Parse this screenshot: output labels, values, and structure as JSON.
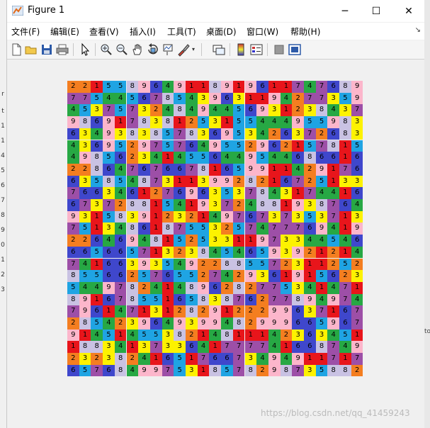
{
  "window": {
    "title": "Figure 1",
    "controls": {
      "minimize": "─",
      "maximize": "☐",
      "close": "✕"
    }
  },
  "menu": [
    "文件(F)",
    "编辑(E)",
    "查看(V)",
    "插入(I)",
    "工具(T)",
    "桌面(D)",
    "窗口(W)",
    "帮助(H)"
  ],
  "toolbar_icons": [
    "new-figure-icon",
    "open-icon",
    "save-icon",
    "print-icon",
    "pointer-icon",
    "zoom-in-icon",
    "zoom-out-icon",
    "pan-icon",
    "rotate-icon",
    "data-cursor-icon",
    "brush-icon",
    "link-icon",
    "colorbar-icon",
    "legend-icon",
    "hide-plot-tools-icon",
    "show-plot-tools-icon"
  ],
  "palette": {
    "1": "#e8151b",
    "2": "#f47e20",
    "3": "#fdf200",
    "4": "#27a844",
    "5": "#1fa4e3",
    "6": "#3f47cc",
    "7": "#9d4fa7",
    "8": "#c9c2e3",
    "9": "#fcb6cb"
  },
  "grid": [
    [
      2,
      2,
      1,
      5,
      5,
      8,
      9,
      6,
      4,
      9,
      1,
      1,
      8,
      9,
      1,
      9,
      6,
      1,
      1,
      7,
      4,
      7,
      6,
      8,
      9
    ],
    [
      7,
      7,
      5,
      4,
      4,
      5,
      6,
      7,
      8,
      5,
      4,
      3,
      9,
      6,
      3,
      1,
      1,
      9,
      4,
      2,
      7,
      7,
      3,
      5,
      9
    ],
    [
      4,
      5,
      3,
      7,
      5,
      7,
      3,
      2,
      4,
      8,
      4,
      9,
      4,
      4,
      5,
      6,
      9,
      3,
      1,
      2,
      3,
      8,
      4,
      3,
      7
    ],
    [
      9,
      8,
      6,
      9,
      1,
      7,
      8,
      3,
      8,
      1,
      2,
      5,
      3,
      1,
      5,
      5,
      4,
      4,
      4,
      9,
      5,
      5,
      9,
      8,
      3
    ],
    [
      6,
      3,
      4,
      9,
      3,
      8,
      3,
      8,
      5,
      7,
      8,
      3,
      6,
      9,
      5,
      3,
      4,
      2,
      6,
      3,
      7,
      2,
      6,
      8,
      3
    ],
    [
      4,
      3,
      6,
      9,
      5,
      2,
      9,
      7,
      5,
      7,
      6,
      4,
      9,
      5,
      5,
      2,
      9,
      6,
      2,
      1,
      5,
      7,
      8,
      1,
      5
    ],
    [
      4,
      9,
      8,
      5,
      6,
      2,
      3,
      4,
      1,
      4,
      5,
      5,
      6,
      4,
      4,
      9,
      5,
      4,
      4,
      6,
      8,
      6,
      6,
      1,
      6
    ],
    [
      2,
      2,
      8,
      6,
      4,
      7,
      6,
      7,
      6,
      6,
      7,
      8,
      1,
      6,
      5,
      9,
      9,
      1,
      1,
      4,
      2,
      9,
      1,
      7,
      6
    ],
    [
      6,
      3,
      5,
      8,
      5,
      4,
      8,
      7,
      3,
      1,
      1,
      3,
      9,
      9,
      2,
      8,
      2,
      1,
      6,
      7,
      2,
      5,
      1,
      3,
      3
    ],
    [
      7,
      6,
      6,
      3,
      4,
      6,
      1,
      2,
      7,
      6,
      9,
      6,
      3,
      5,
      3,
      7,
      8,
      4,
      3,
      1,
      7,
      4,
      4,
      1,
      6
    ],
    [
      6,
      7,
      3,
      7,
      2,
      8,
      8,
      1,
      5,
      4,
      1,
      9,
      3,
      7,
      2,
      4,
      8,
      8,
      1,
      9,
      3,
      8,
      7,
      6,
      4
    ],
    [
      9,
      3,
      1,
      5,
      8,
      3,
      9,
      1,
      2,
      3,
      2,
      1,
      4,
      9,
      7,
      6,
      7,
      3,
      7,
      3,
      5,
      3,
      7,
      1,
      3
    ],
    [
      7,
      5,
      1,
      3,
      4,
      8,
      6,
      1,
      8,
      7,
      5,
      5,
      3,
      2,
      5,
      7,
      4,
      7,
      7,
      7,
      6,
      9,
      4,
      1,
      9
    ],
    [
      2,
      2,
      6,
      4,
      6,
      9,
      4,
      8,
      1,
      5,
      2,
      5,
      3,
      3,
      1,
      1,
      9,
      7,
      3,
      3,
      4,
      4,
      5,
      4,
      6
    ],
    [
      6,
      6,
      5,
      6,
      6,
      5,
      7,
      1,
      3,
      2,
      3,
      8,
      4,
      5,
      4,
      6,
      5,
      9,
      3,
      9,
      2,
      1,
      2,
      1,
      4
    ],
    [
      7,
      4,
      1,
      6,
      6,
      3,
      9,
      3,
      5,
      4,
      9,
      2,
      2,
      8,
      8,
      5,
      5,
      7,
      2,
      3,
      1,
      1,
      2,
      5,
      2
    ],
    [
      8,
      5,
      5,
      6,
      6,
      2,
      5,
      7,
      6,
      5,
      5,
      2,
      7,
      4,
      2,
      9,
      3,
      6,
      1,
      9,
      1,
      5,
      6,
      2,
      3
    ],
    [
      5,
      4,
      4,
      9,
      7,
      8,
      2,
      4,
      1,
      4,
      8,
      9,
      6,
      2,
      8,
      2,
      7,
      7,
      5,
      3,
      4,
      1,
      4,
      7,
      1
    ],
    [
      8,
      9,
      1,
      6,
      7,
      8,
      5,
      5,
      1,
      6,
      5,
      8,
      3,
      8,
      7,
      6,
      2,
      7,
      7,
      8,
      9,
      4,
      9,
      7,
      4
    ],
    [
      7,
      9,
      6,
      1,
      4,
      7,
      1,
      3,
      1,
      2,
      8,
      2,
      9,
      1,
      2,
      2,
      2,
      9,
      9,
      6,
      3,
      7,
      1,
      6,
      7
    ],
    [
      2,
      8,
      5,
      4,
      2,
      3,
      9,
      6,
      4,
      9,
      3,
      9,
      9,
      4,
      8,
      2,
      9,
      9,
      9,
      6,
      6,
      5,
      9,
      6,
      7
    ],
    [
      9,
      1,
      4,
      5,
      1,
      4,
      5,
      5,
      3,
      8,
      2,
      1,
      4,
      8,
      1,
      1,
      1,
      4,
      2,
      3,
      6,
      3,
      4,
      5,
      1
    ],
    [
      1,
      8,
      8,
      3,
      4,
      1,
      3,
      7,
      3,
      3,
      6,
      4,
      1,
      7,
      7,
      7,
      7,
      4,
      1,
      6,
      6,
      8,
      7,
      4,
      9
    ],
    [
      2,
      3,
      2,
      3,
      8,
      2,
      4,
      1,
      6,
      5,
      1,
      7,
      6,
      6,
      7,
      3,
      4,
      9,
      4,
      9,
      1,
      1,
      7,
      1,
      7
    ],
    [
      6,
      5,
      7,
      6,
      8,
      4,
      9,
      9,
      7,
      5,
      3,
      1,
      8,
      5,
      7,
      8,
      2,
      9,
      8,
      7,
      3,
      5,
      8,
      8,
      2
    ]
  ],
  "left_ticks": [
    "r",
    "t",
    "1",
    "1",
    "4",
    "5",
    "6",
    "7",
    "8",
    "9",
    "0",
    "1",
    "2",
    "3"
  ],
  "right_labels": [
    "to"
  ],
  "watermark": "https://blog.csdn.net/qq_41459243"
}
